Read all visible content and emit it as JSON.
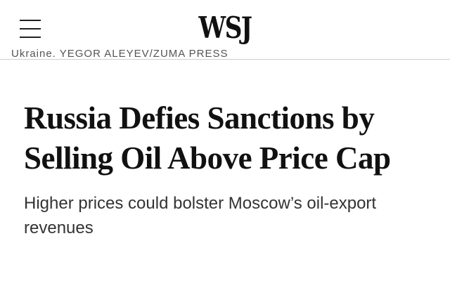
{
  "header": {
    "logo_text": "WSJ",
    "menu_icon": "hamburger-menu-icon"
  },
  "photo": {
    "credit": "Ukraine. YEGOR ALEYEV/ZUMA PRESS"
  },
  "article": {
    "headline": "Russia Defies Sanctions by Selling Oil Above Price Cap",
    "dek": "Higher prices could bolster Moscow’s oil-export revenues"
  },
  "colors": {
    "background": "#ffffff",
    "text": "#111111",
    "dek_text": "#333333",
    "divider": "#cfcfcf"
  }
}
